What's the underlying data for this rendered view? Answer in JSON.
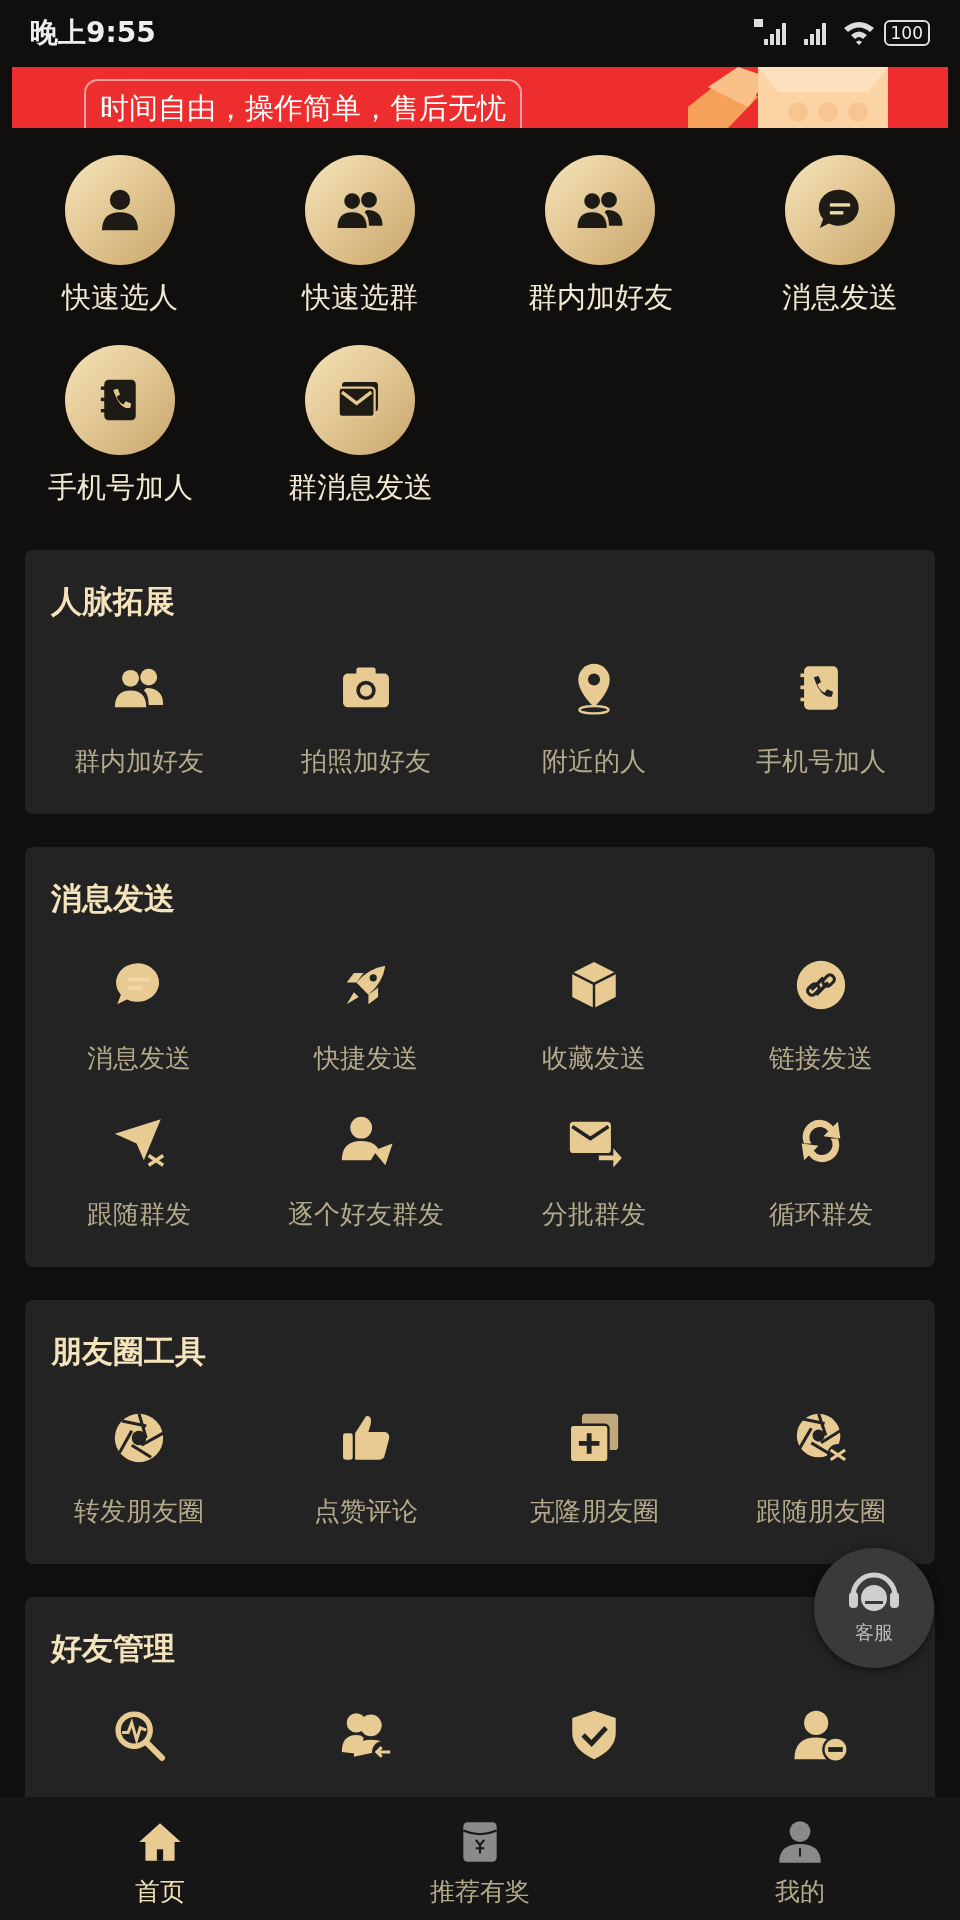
{
  "status_bar": {
    "time": "晚上9:55",
    "battery": "100"
  },
  "banner": {
    "text": "时间自由，操作简单，售后无忧"
  },
  "quick_actions": [
    {
      "label": "快速选人"
    },
    {
      "label": "快速选群"
    },
    {
      "label": "群内加好友"
    },
    {
      "label": "消息发送"
    },
    {
      "label": "手机号加人"
    },
    {
      "label": "群消息发送"
    }
  ],
  "sections": [
    {
      "title": "人脉拓展",
      "items": [
        {
          "label": "群内加好友"
        },
        {
          "label": "拍照加好友"
        },
        {
          "label": "附近的人"
        },
        {
          "label": "手机号加人"
        }
      ]
    },
    {
      "title": "消息发送",
      "items": [
        {
          "label": "消息发送"
        },
        {
          "label": "快捷发送"
        },
        {
          "label": "收藏发送"
        },
        {
          "label": "链接发送"
        },
        {
          "label": "跟随群发"
        },
        {
          "label": "逐个好友群发"
        },
        {
          "label": "分批群发"
        },
        {
          "label": "循环群发"
        }
      ]
    },
    {
      "title": "朋友圈工具",
      "items": [
        {
          "label": "转发朋友圈"
        },
        {
          "label": "点赞评论"
        },
        {
          "label": "克隆朋友圈"
        },
        {
          "label": "跟随朋友圈"
        }
      ]
    },
    {
      "title": "好友管理"
    }
  ],
  "float_button": {
    "label": "客服"
  },
  "bottom_nav": [
    {
      "label": "首页",
      "selected": true
    },
    {
      "label": "推荐有奖",
      "selected": false
    },
    {
      "label": "我的",
      "selected": false
    }
  ]
}
